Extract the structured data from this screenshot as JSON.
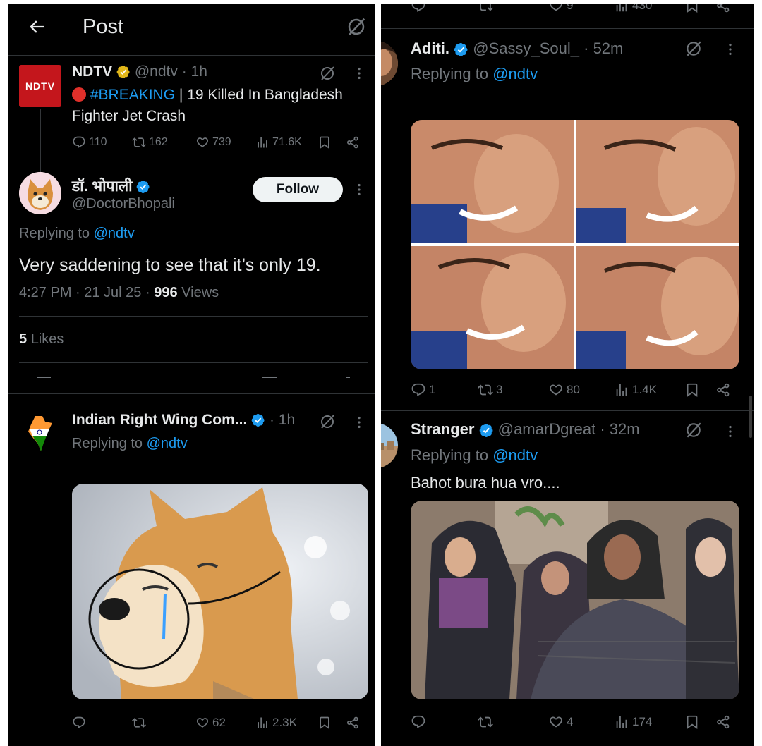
{
  "header": {
    "title": "Post"
  },
  "parent_tweet": {
    "avatar_text": "NDTV",
    "name": "NDTV",
    "handle": "@ndtv",
    "time": "· 1h",
    "breaking_tag": "#BREAKING",
    "text_line1": "| 19 Killed In Bangladesh",
    "text_line2": "Fighter Jet Crash",
    "replies": "110",
    "reposts": "162",
    "likes": "739",
    "views": "71.6K"
  },
  "main_tweet": {
    "name": "डॉ. भोपाली",
    "handle": "@DoctorBhopali",
    "follow_label": "Follow",
    "replying_prefix": "Replying to",
    "replying_handle": "@ndtv",
    "text": "Very saddening to see that it’s only 19.",
    "timestamp": "4:27 PM · 21 Jul 25 ·",
    "views_count": "996",
    "views_label": "Views",
    "likes_count": "5",
    "likes_label": "Likes"
  },
  "reply_irw": {
    "name": "Indian Right Wing Com...",
    "time": "· 1h",
    "replying_prefix": "Replying to",
    "replying_handle": "@ndtv",
    "replies": "",
    "reposts": "",
    "likes": "62",
    "views": "2.3K"
  },
  "top_right_actions": {
    "likes": "9",
    "views": "430"
  },
  "reply_aditi": {
    "name": "Aditi.",
    "handle": "@Sassy_Soul_",
    "time": "· 52m",
    "replying_prefix": "Replying to",
    "replying_handle": "@ndtv",
    "replies": "1",
    "reposts": "3",
    "likes": "80",
    "views": "1.4K"
  },
  "reply_stranger": {
    "name": "Stranger",
    "handle": "@amarDgreat",
    "time": "· 32m",
    "replying_prefix": "Replying to",
    "replying_handle": "@ndtv",
    "text": "Bahot bura hua vro....",
    "replies": "",
    "reposts": "",
    "likes": "4",
    "views": "174"
  },
  "colors": {
    "background": "#000000",
    "text": "#e7e9ea",
    "muted": "#71767b",
    "accent": "#1d9bf0",
    "divider": "#2f3336",
    "ndtv_red": "#c4161c",
    "gold_badge": "#e2b719"
  }
}
